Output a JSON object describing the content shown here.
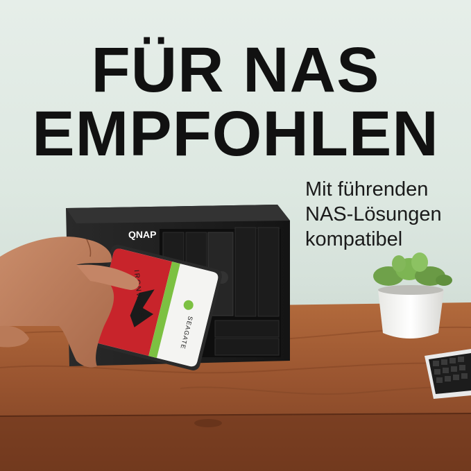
{
  "headline": {
    "line1": "FÜR NAS",
    "line2": "EMPFOHLEN"
  },
  "subtext": {
    "line1": "Mit führenden",
    "line2": "NAS-Lösungen",
    "line3": "kompatibel"
  },
  "nas": {
    "brand": "QNAP"
  },
  "drive": {
    "product": "IRONWOLF",
    "brand": "SEAGATE"
  },
  "colors": {
    "background": "#dfe8e1",
    "text": "#111111",
    "desk": "#a8643a",
    "drive_red": "#c8242b",
    "drive_green": "#7cc142",
    "nas_body": "#1d1d1d"
  }
}
